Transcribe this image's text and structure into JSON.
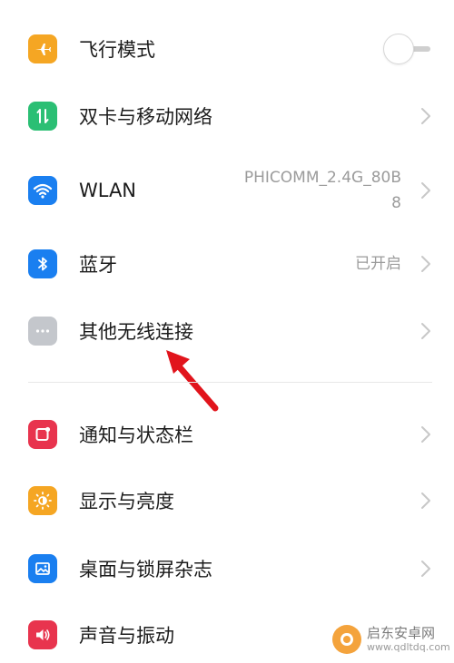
{
  "colors": {
    "airplane": "#f5a623",
    "mobile_network": "#2bbf74",
    "wlan": "#1a7ff0",
    "bluetooth": "#1a7ff0",
    "other_wireless": "#c4c7cc",
    "notification": "#e8344e",
    "display": "#f5a623",
    "desktop": "#1a7ff0",
    "sound": "#e8344e",
    "annotation_arrow": "#e1141c"
  },
  "settings": {
    "airplane": {
      "label": "飞行模式",
      "icon": "airplane-icon",
      "toggle_on": false
    },
    "mobile_network": {
      "label": "双卡与移动网络",
      "icon": "data-transfer-icon"
    },
    "wlan": {
      "label": "WLAN",
      "icon": "wifi-icon",
      "value_line1": "PHICOMM_2.4G_80B",
      "value_line2": "8"
    },
    "bluetooth": {
      "label": "蓝牙",
      "icon": "bluetooth-icon",
      "value": "已开启"
    },
    "other_wireless": {
      "label": "其他无线连接",
      "icon": "more-dots-icon"
    },
    "notification": {
      "label": "通知与状态栏",
      "icon": "notification-icon"
    },
    "display": {
      "label": "显示与亮度",
      "icon": "brightness-icon"
    },
    "desktop": {
      "label": "桌面与锁屏杂志",
      "icon": "wallpaper-icon"
    },
    "sound": {
      "label": "声音与振动",
      "icon": "speaker-icon"
    }
  },
  "watermark": {
    "title": "启东安卓网",
    "subtitle": "www.qdltdq.com"
  }
}
